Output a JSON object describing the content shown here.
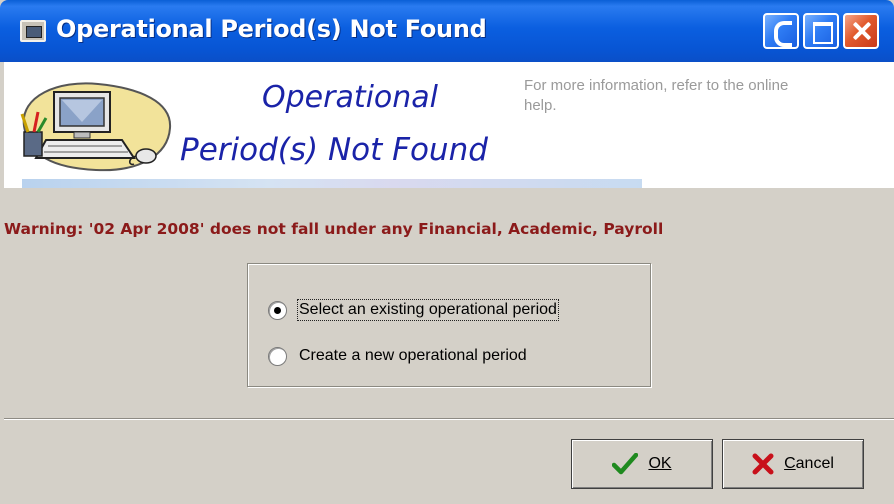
{
  "window": {
    "title": "Operational Period(s) Not Found"
  },
  "header": {
    "title_line1": "Operational",
    "title_line2": "Period(s) Not Found",
    "help_text": "For more information, refer to the online help."
  },
  "warning": {
    "text": "Warning: '02 Apr 2008' does not fall under any Financial, Academic, Payroll"
  },
  "options": [
    {
      "label": "Select an existing operational period",
      "checked": true
    },
    {
      "label": "Create a new operational period",
      "checked": false
    }
  ],
  "buttons": {
    "ok_label": "OK",
    "cancel_label": "Cancel"
  },
  "icons": {
    "ok": "checkmark-icon",
    "cancel": "x-icon",
    "window": "window-app-icon",
    "logo": "computer-logo-icon"
  },
  "colors": {
    "title_bar": "#0b5fe0",
    "header_title": "#1a23a8",
    "warning": "#8b1a1a",
    "ok_check": "#1f8a1f",
    "cancel_x": "#c8101a"
  }
}
